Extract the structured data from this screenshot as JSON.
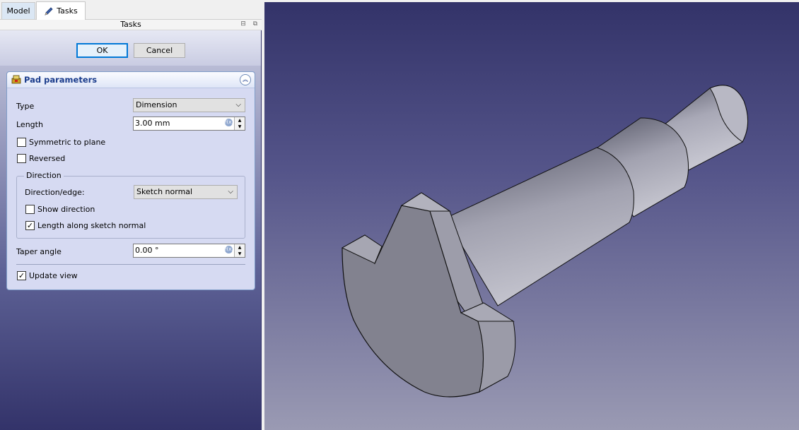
{
  "tabs": {
    "model": "Model",
    "tasks": "Tasks"
  },
  "panel": {
    "title": "Tasks"
  },
  "buttons": {
    "ok": "OK",
    "cancel": "Cancel"
  },
  "pad": {
    "title": "Pad parameters",
    "type_label": "Type",
    "type_value": "Dimension",
    "length_label": "Length",
    "length_value": "3.00 mm",
    "symmetric_label": "Symmetric to plane",
    "symmetric_checked": false,
    "reversed_label": "Reversed",
    "reversed_checked": false,
    "direction": {
      "title": "Direction",
      "edge_label": "Direction/edge:",
      "edge_value": "Sketch normal",
      "show_direction_label": "Show direction",
      "show_direction_checked": false,
      "along_normal_label": "Length along sketch normal",
      "along_normal_checked": true
    },
    "taper_label": "Taper angle",
    "taper_value": "0.00 °",
    "update_view_label": "Update view",
    "update_view_checked": true
  },
  "icons": {
    "tasks_tab": "pencil-icon",
    "pad": "pad-feature-icon",
    "collapse": "chevron-double-up-icon",
    "expression": "fx-icon",
    "combo": "chevron-down-icon",
    "spin": "spin-arrows-icon"
  },
  "colors": {
    "view_top": "#333369",
    "view_bottom": "#9a9ab3",
    "panel_bg": "#d6daf2",
    "accent": "#0078d7",
    "part_face": "#8c8c98"
  }
}
